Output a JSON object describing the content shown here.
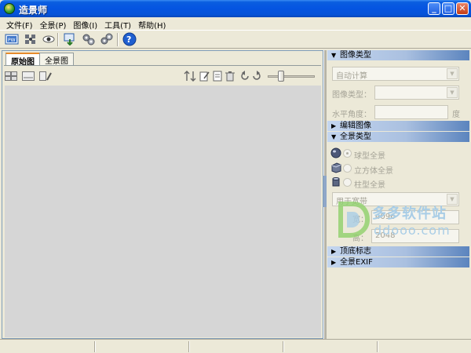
{
  "window": {
    "title": "造景师"
  },
  "menu": [
    {
      "label": "文件(F)"
    },
    {
      "label": "全景(P)"
    },
    {
      "label": "图像(I)"
    },
    {
      "label": "工具(T)"
    },
    {
      "label": "帮助(H)"
    }
  ],
  "toolbar": {
    "icons": [
      "pw-icon",
      "stitch-icon",
      "preview-eye-icon",
      "export-icon",
      "settings-gears-icon",
      "batch-gears-icon",
      "help-icon"
    ]
  },
  "left": {
    "tabs": [
      {
        "label": "原始图",
        "active": true
      },
      {
        "label": "全景图",
        "active": false
      }
    ],
    "left_tool_icons": [
      "view-large-icon",
      "view-list-icon",
      "view-edit-icon"
    ],
    "right_tool_icons": [
      "sort-icon",
      "edit-icon",
      "copy-icon",
      "delete-icon",
      "rotate-left-icon",
      "rotate-right-icon"
    ],
    "zoom_slider_level": 0.25
  },
  "right": {
    "image_type_section": {
      "title": "图像类型",
      "mode_value": "自动计算",
      "image_type_label": "图像类型：",
      "image_type_value": "",
      "horizontal_angle_label": "水平角度：",
      "horizontal_angle_value": "",
      "unit": "度"
    },
    "edit_image_section": {
      "title": "编辑图像"
    },
    "panorama_type_section": {
      "title": "全景类型",
      "options": [
        {
          "label": "球型全景",
          "checked": true
        },
        {
          "label": "立方体全景",
          "checked": false
        },
        {
          "label": "柱型全景",
          "checked": false
        }
      ],
      "usage_value": "用于宽带",
      "width_label": "宽：",
      "width_value": "4096",
      "height_label": "高：",
      "height_value": "2048"
    },
    "nadir_section": {
      "title": "顶底标志"
    },
    "exif_section": {
      "title": "全景EXIF"
    }
  },
  "watermark": {
    "text": "多多软件站",
    "url": "ddooo.com"
  },
  "colors": {
    "titlebar": "#0554e1",
    "section_header": "#aac0e0",
    "canvas": "#d6d6d6",
    "watermark": "#a9cde6"
  }
}
